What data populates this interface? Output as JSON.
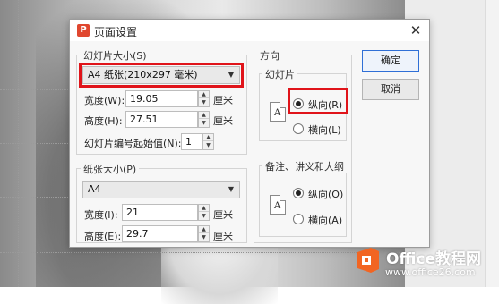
{
  "dialog": {
    "title": "页面设置",
    "app_icon_glyph": "P",
    "close_glyph": "✕"
  },
  "slide_size": {
    "group_label": "幻灯片大小(S)",
    "selected": "A4 纸张(210x297 毫米)",
    "width_label": "宽度(W):",
    "width_value": "19.05",
    "width_unit": "厘米",
    "height_label": "高度(H):",
    "height_value": "27.51",
    "height_unit": "厘米",
    "start_number_label": "幻灯片编号起始值(N):",
    "start_number_value": "1"
  },
  "paper_size": {
    "group_label": "纸张大小(P)",
    "selected": "A4",
    "width_label": "宽度(I):",
    "width_value": "21",
    "width_unit": "厘米",
    "height_label": "高度(E):",
    "height_value": "29.7",
    "height_unit": "厘米"
  },
  "orientation": {
    "group_label": "方向",
    "slides": {
      "group_label": "幻灯片",
      "portrait_label": "纵向(R)",
      "landscape_label": "横向(L)",
      "selected": "portrait"
    },
    "notes": {
      "group_label": "备注、讲义和大纲",
      "portrait_label": "纵向(O)",
      "landscape_label": "横向(A)",
      "selected": "portrait"
    },
    "page_icon_glyph": "A"
  },
  "buttons": {
    "ok_label": "确定",
    "cancel_label": "取消"
  },
  "watermark": {
    "brand": "Office教程网",
    "url": "www.office26.com"
  },
  "colors": {
    "highlight": "#e0141a",
    "logo_orange": "#f26522",
    "app_icon": "#e0472f"
  }
}
